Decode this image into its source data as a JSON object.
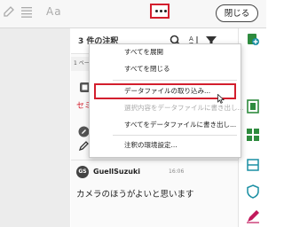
{
  "toolbar": {
    "font_label": "Aa",
    "close_label": "閉じる"
  },
  "panel": {
    "title": "3 件の注釈",
    "page_tag": "1 ペー",
    "red_snippet": "セミ",
    "comment": {
      "author_initials": "GS",
      "author": "GuellSuzuki",
      "time": "16:06",
      "text": "カメラのほうがよいと思います"
    }
  },
  "menu": {
    "items": [
      "すべてを展開",
      "すべてを閉じる",
      "データファイルの取り込み...",
      "選択内容をデータファイルに書き出し...",
      "すべてをデータファイルに書き出し...",
      "注釈の環境設定..."
    ],
    "highlighted_item": "データファイルの取り込み..."
  },
  "colors": {
    "highlight_red": "#d31e2d",
    "strip_green": "#2e8b3e",
    "strip_teal": "#1a8fa3",
    "strip_pink": "#c2185b"
  }
}
